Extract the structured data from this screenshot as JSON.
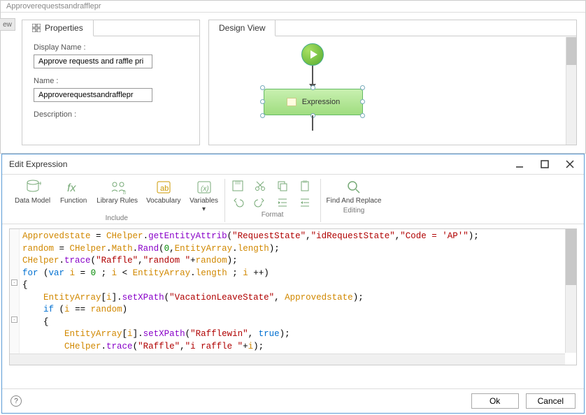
{
  "top": {
    "title": "Approverequestsandrafflepr",
    "left_tab": "ew",
    "properties_tab": "Properties",
    "display_name_label": "Display Name :",
    "display_name_value": "Approve requests and raffle pri",
    "name_label": "Name :",
    "name_value": "Approverequestsandrafflepr",
    "description_label": "Description :",
    "design_view_tab": "Design View",
    "expr_node_label": "Expression"
  },
  "dialog": {
    "title": "Edit Expression",
    "ribbon": {
      "data_model": "Data Model",
      "function": "Function",
      "library_rules": "Library Rules",
      "vocabulary": "Vocabulary",
      "variables": "Variables",
      "include_group": "Include",
      "format_group": "Format",
      "editing_group": "Editing",
      "find_replace": "Find And Replace"
    },
    "code": {
      "lines": [
        {
          "segments": [
            [
              "ident",
              "Approvedstate"
            ],
            [
              "norm",
              " = "
            ],
            [
              "ident",
              "CHelper"
            ],
            [
              "norm",
              "."
            ],
            [
              "fn",
              "getEntityAttrib"
            ],
            [
              "norm",
              "("
            ],
            [
              "str",
              "\"RequestState\""
            ],
            [
              "norm",
              ","
            ],
            [
              "str",
              "\"idRequestState\""
            ],
            [
              "norm",
              ","
            ],
            [
              "str",
              "\"Code = 'AP'\""
            ],
            [
              "norm",
              ");"
            ]
          ]
        },
        {
          "segments": [
            [
              "ident",
              "random"
            ],
            [
              "norm",
              " = "
            ],
            [
              "ident",
              "CHelper"
            ],
            [
              "norm",
              "."
            ],
            [
              "ident",
              "Math"
            ],
            [
              "norm",
              "."
            ],
            [
              "fn",
              "Rand"
            ],
            [
              "norm",
              "("
            ],
            [
              "num",
              "0"
            ],
            [
              "norm",
              ","
            ],
            [
              "ident",
              "EntityArray"
            ],
            [
              "norm",
              "."
            ],
            [
              "ident",
              "length"
            ],
            [
              "norm",
              ");"
            ]
          ]
        },
        {
          "segments": [
            [
              "ident",
              "CHelper"
            ],
            [
              "norm",
              "."
            ],
            [
              "fn",
              "trace"
            ],
            [
              "norm",
              "("
            ],
            [
              "str",
              "\"Raffle\""
            ],
            [
              "norm",
              ","
            ],
            [
              "str",
              "\"random \""
            ],
            [
              "norm",
              "+"
            ],
            [
              "ident",
              "random"
            ],
            [
              "norm",
              ");"
            ]
          ]
        },
        {
          "segments": [
            [
              "kw",
              "for"
            ],
            [
              "norm",
              " ("
            ],
            [
              "kw",
              "var"
            ],
            [
              "norm",
              " "
            ],
            [
              "ident",
              "i"
            ],
            [
              "norm",
              " = "
            ],
            [
              "num",
              "0"
            ],
            [
              "norm",
              " ; "
            ],
            [
              "ident",
              "i"
            ],
            [
              "norm",
              " < "
            ],
            [
              "ident",
              "EntityArray"
            ],
            [
              "norm",
              "."
            ],
            [
              "ident",
              "length"
            ],
            [
              "norm",
              " ; "
            ],
            [
              "ident",
              "i"
            ],
            [
              "norm",
              " ++)"
            ]
          ]
        },
        {
          "fold": true,
          "segments": [
            [
              "norm",
              "{"
            ]
          ]
        },
        {
          "indent": 1,
          "segments": [
            [
              "ident",
              "EntityArray"
            ],
            [
              "norm",
              "["
            ],
            [
              "ident",
              "i"
            ],
            [
              "norm",
              "]."
            ],
            [
              "fn",
              "setXPath"
            ],
            [
              "norm",
              "("
            ],
            [
              "str",
              "\"VacationLeaveState\""
            ],
            [
              "norm",
              ", "
            ],
            [
              "ident",
              "Approvedstate"
            ],
            [
              "norm",
              ");"
            ]
          ]
        },
        {
          "indent": 1,
          "segments": [
            [
              "kw",
              "if"
            ],
            [
              "norm",
              " ("
            ],
            [
              "ident",
              "i"
            ],
            [
              "norm",
              " == "
            ],
            [
              "ident",
              "random"
            ],
            [
              "norm",
              ")"
            ]
          ]
        },
        {
          "fold": true,
          "indent": 1,
          "segments": [
            [
              "norm",
              "{"
            ]
          ]
        },
        {
          "indent": 2,
          "segments": [
            [
              "ident",
              "EntityArray"
            ],
            [
              "norm",
              "["
            ],
            [
              "ident",
              "i"
            ],
            [
              "norm",
              "]."
            ],
            [
              "fn",
              "setXPath"
            ],
            [
              "norm",
              "("
            ],
            [
              "str",
              "\"Rafflewin\""
            ],
            [
              "norm",
              ", "
            ],
            [
              "bool",
              "true"
            ],
            [
              "norm",
              ");"
            ]
          ]
        },
        {
          "indent": 2,
          "segments": [
            [
              "ident",
              "CHelper"
            ],
            [
              "norm",
              "."
            ],
            [
              "fn",
              "trace"
            ],
            [
              "norm",
              "("
            ],
            [
              "str",
              "\"Raffle\""
            ],
            [
              "norm",
              ","
            ],
            [
              "str",
              "\"i raffle \""
            ],
            [
              "norm",
              "+"
            ],
            [
              "ident",
              "i"
            ],
            [
              "norm",
              ");"
            ]
          ]
        },
        {
          "segments": [
            [
              "norm",
              ""
            ]
          ]
        },
        {
          "indent": 1,
          "segments": [
            [
              "norm",
              "}"
            ]
          ]
        }
      ]
    },
    "ok": "Ok",
    "cancel": "Cancel"
  }
}
